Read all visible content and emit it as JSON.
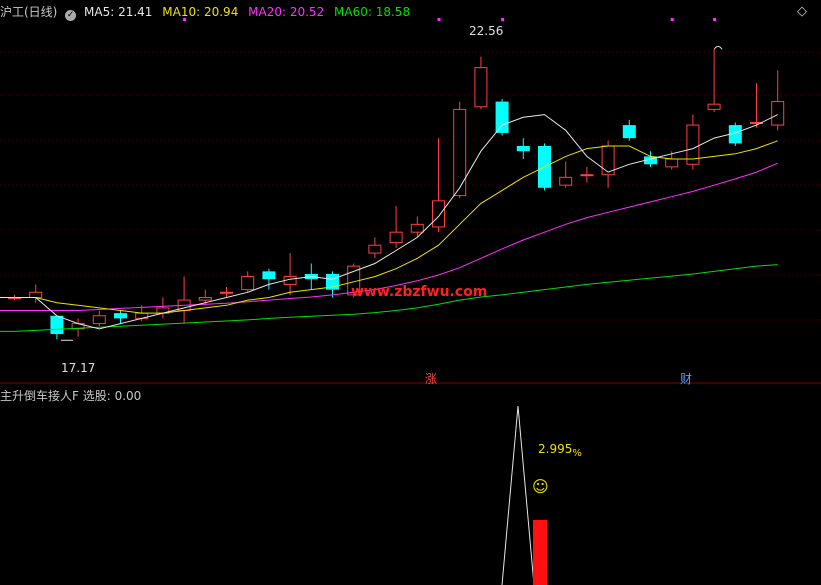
{
  "header": {
    "title": "沪工(日线)",
    "ma5_label": "MA5: 21.41",
    "ma10_label": "MA10: 20.94",
    "ma20_label": "MA20: 20.52",
    "ma60_label": "MA60: 18.58"
  },
  "annotations": {
    "high_label": "22.56",
    "low_label": "17.17",
    "rise_marker": "涨",
    "finance_marker": "财"
  },
  "watermark": "www.zbzfwu.com",
  "indicator": {
    "title": "主升倒车接人F  选股: 0.00",
    "pct_label": "2.995",
    "pct_sign": "%",
    "smile": "☺"
  },
  "colors": {
    "up": "#ff4040",
    "down": "#00ffff",
    "ma5": "#e6e6e6",
    "ma10": "#f0e000",
    "ma20": "#ff30ff",
    "ma60": "#00e000",
    "watermark": "#ff2020",
    "grid": "#4d0000"
  },
  "chart_data": {
    "type": "candlestick",
    "ylim": [
      16.6,
      23.3
    ],
    "candles": [
      {
        "o": 17.95,
        "c": 17.95,
        "h": 18.0,
        "l": 17.9
      },
      {
        "o": 17.95,
        "c": 18.05,
        "h": 18.2,
        "l": 17.85
      },
      {
        "o": 17.6,
        "c": 17.25,
        "h": 17.6,
        "l": 17.15
      },
      {
        "o": 17.35,
        "c": 17.45,
        "h": 17.55,
        "l": 17.2
      },
      {
        "o": 17.45,
        "c": 17.6,
        "h": 17.7,
        "l": 17.4
      },
      {
        "o": 17.65,
        "c": 17.55,
        "h": 17.7,
        "l": 17.45
      },
      {
        "o": 17.55,
        "c": 17.65,
        "h": 17.8,
        "l": 17.5
      },
      {
        "o": 17.65,
        "c": 17.75,
        "h": 17.95,
        "l": 17.55
      },
      {
        "o": 17.7,
        "c": 17.9,
        "h": 18.35,
        "l": 17.45
      },
      {
        "o": 17.9,
        "c": 17.95,
        "h": 18.1,
        "l": 17.8
      },
      {
        "o": 18.05,
        "c": 18.05,
        "h": 18.15,
        "l": 17.95
      },
      {
        "o": 18.1,
        "c": 18.35,
        "h": 18.45,
        "l": 18.05
      },
      {
        "o": 18.45,
        "c": 18.3,
        "h": 18.5,
        "l": 18.1
      },
      {
        "o": 18.2,
        "c": 18.35,
        "h": 18.8,
        "l": 18.0
      },
      {
        "o": 18.4,
        "c": 18.3,
        "h": 18.6,
        "l": 18.1
      },
      {
        "o": 18.4,
        "c": 18.1,
        "h": 18.45,
        "l": 17.95
      },
      {
        "o": 18.0,
        "c": 18.55,
        "h": 18.6,
        "l": 17.95
      },
      {
        "o": 18.8,
        "c": 18.95,
        "h": 19.1,
        "l": 18.7
      },
      {
        "o": 19.0,
        "c": 19.2,
        "h": 19.7,
        "l": 18.9
      },
      {
        "o": 19.2,
        "c": 19.35,
        "h": 19.5,
        "l": 19.1
      },
      {
        "o": 19.3,
        "c": 19.8,
        "h": 21.0,
        "l": 19.2
      },
      {
        "o": 19.9,
        "c": 21.55,
        "h": 21.7,
        "l": 19.85
      },
      {
        "o": 21.6,
        "c": 22.35,
        "h": 22.56,
        "l": 21.55
      },
      {
        "o": 21.7,
        "c": 21.1,
        "h": 21.75,
        "l": 21.05
      },
      {
        "o": 20.85,
        "c": 20.75,
        "h": 21.0,
        "l": 20.6
      },
      {
        "o": 20.85,
        "c": 20.05,
        "h": 20.9,
        "l": 20.0
      },
      {
        "o": 20.1,
        "c": 20.25,
        "h": 20.55,
        "l": 20.05
      },
      {
        "o": 20.3,
        "c": 20.3,
        "h": 20.45,
        "l": 20.15
      },
      {
        "o": 20.3,
        "c": 20.85,
        "h": 20.95,
        "l": 20.05
      },
      {
        "o": 21.25,
        "c": 21.0,
        "h": 21.35,
        "l": 20.95
      },
      {
        "o": 20.65,
        "c": 20.5,
        "h": 20.75,
        "l": 20.45
      },
      {
        "o": 20.45,
        "c": 20.6,
        "h": 20.75,
        "l": 20.4
      },
      {
        "o": 20.5,
        "c": 21.25,
        "h": 21.45,
        "l": 20.4
      },
      {
        "o": 21.55,
        "c": 21.65,
        "h": 22.7,
        "l": 21.5
      },
      {
        "o": 21.25,
        "c": 20.9,
        "h": 21.3,
        "l": 20.85
      },
      {
        "o": 21.3,
        "c": 21.3,
        "h": 22.05,
        "l": 21.2
      },
      {
        "o": 21.25,
        "c": 21.7,
        "h": 22.3,
        "l": 21.15
      }
    ],
    "ma5": [
      17.95,
      17.95,
      17.6,
      17.45,
      17.35,
      17.45,
      17.55,
      17.65,
      17.75,
      17.85,
      17.95,
      18.05,
      18.2,
      18.3,
      18.35,
      18.3,
      18.45,
      18.6,
      18.85,
      19.1,
      19.5,
      20.05,
      20.75,
      21.25,
      21.4,
      21.45,
      21.15,
      20.65,
      20.35,
      20.5,
      20.6,
      20.7,
      20.8,
      21.0,
      21.1,
      21.25,
      21.45
    ],
    "ma10": [
      17.95,
      17.95,
      17.85,
      17.8,
      17.75,
      17.7,
      17.65,
      17.65,
      17.7,
      17.75,
      17.8,
      17.9,
      17.95,
      18.05,
      18.1,
      18.15,
      18.25,
      18.35,
      18.5,
      18.7,
      18.95,
      19.35,
      19.75,
      20.0,
      20.25,
      20.45,
      20.65,
      20.8,
      20.85,
      20.85,
      20.65,
      20.6,
      20.6,
      20.65,
      20.7,
      20.8,
      20.95
    ],
    "ma20": [
      17.7,
      17.7,
      17.7,
      17.7,
      17.72,
      17.74,
      17.76,
      17.78,
      17.8,
      17.82,
      17.84,
      17.87,
      17.9,
      17.93,
      17.96,
      18.0,
      18.05,
      18.1,
      18.18,
      18.27,
      18.38,
      18.52,
      18.7,
      18.88,
      19.05,
      19.2,
      19.35,
      19.48,
      19.58,
      19.68,
      19.78,
      19.88,
      19.98,
      20.1,
      20.22,
      20.35,
      20.52
    ],
    "ma60": [
      17.3,
      17.32,
      17.34,
      17.36,
      17.38,
      17.4,
      17.42,
      17.44,
      17.46,
      17.48,
      17.5,
      17.52,
      17.55,
      17.57,
      17.59,
      17.61,
      17.63,
      17.66,
      17.7,
      17.75,
      17.82,
      17.9,
      17.96,
      18.0,
      18.05,
      18.1,
      18.15,
      18.2,
      18.24,
      18.28,
      18.32,
      18.36,
      18.4,
      18.45,
      18.5,
      18.55,
      18.58
    ]
  }
}
